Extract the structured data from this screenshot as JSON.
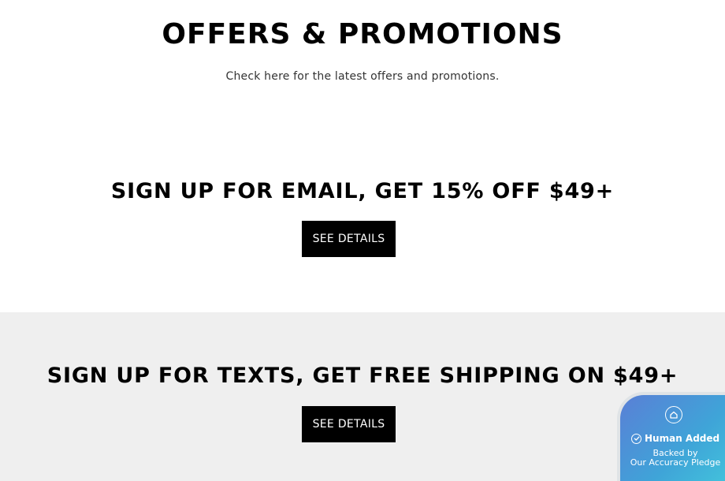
{
  "header": {
    "title": "OFFERS & PROMOTIONS",
    "subtitle": "Check here for the latest offers and promotions."
  },
  "offers": [
    {
      "heading": "SIGN UP FOR EMAIL, GET 15% OFF $49+",
      "button_label": "SEE DETAILS"
    },
    {
      "heading": "SIGN UP FOR TEXTS, GET FREE SHIPPING ON $49+",
      "button_label": "SEE DETAILS"
    }
  ],
  "badge": {
    "title": "Human Added",
    "line1": "Backed by",
    "line2": "Our Accuracy Pledge",
    "icons": [
      "home-icon",
      "check-circle-icon"
    ],
    "gradient": [
      "#5a7fd6",
      "#43c9dc"
    ]
  },
  "colors": {
    "band_background": "#efefef",
    "button_background": "#000000",
    "button_text": "#ffffff"
  }
}
